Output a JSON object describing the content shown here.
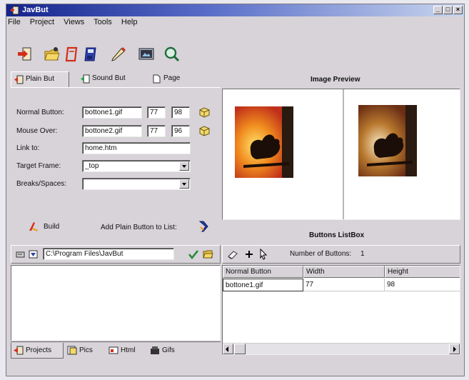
{
  "window": {
    "title": "JavBut",
    "controls": {
      "minimize": "_",
      "maximize": "□",
      "close": "×"
    }
  },
  "menu": [
    "File",
    "Project",
    "Views",
    "Tools",
    "Help"
  ],
  "toolbar_icons": [
    "exit-icon",
    "open-icon",
    "new-icon",
    "save-icon",
    "edit-icon",
    "preview-icon",
    "search-icon"
  ],
  "editor_tabs": [
    {
      "label": "Plain But",
      "icon": "plain-button-icon",
      "active": true
    },
    {
      "label": "Sound But",
      "icon": "sound-button-icon",
      "active": false
    },
    {
      "label": "Page",
      "icon": "page-icon",
      "active": false
    }
  ],
  "form": {
    "normal_button": {
      "label": "Normal Button:",
      "file": "bottone1.gif",
      "width": "77",
      "height": "98"
    },
    "mouse_over": {
      "label": "Mouse Over:",
      "file": "bottone2.gif",
      "width": "77",
      "height": "96"
    },
    "link_to": {
      "label": "Link to:",
      "value": "home.htm"
    },
    "target_frame": {
      "label": "Target Frame:",
      "value": "_top"
    },
    "breaks": {
      "label": "Breaks/Spaces:",
      "value": ""
    }
  },
  "build": {
    "label": "Build",
    "add_label": "Add Plain Button to List:"
  },
  "preview": {
    "heading": "Image Preview"
  },
  "listbox": {
    "heading": "Buttons ListBox",
    "count_label": "Number of Buttons:",
    "count": "1",
    "columns": [
      "Normal Button",
      "Width",
      "Height"
    ],
    "rows": [
      [
        "bottone1.gif",
        "77",
        "98"
      ]
    ]
  },
  "path_bar": {
    "value": "C:\\Program Files\\JavBut"
  },
  "bottom_tabs": [
    {
      "label": "Projects",
      "icon": "projects-icon",
      "active": true
    },
    {
      "label": "Pics",
      "icon": "pics-icon",
      "active": false
    },
    {
      "label": "Html",
      "icon": "html-icon",
      "active": false
    },
    {
      "label": "Gifs",
      "icon": "gifs-icon",
      "active": false
    }
  ],
  "colors": {
    "title_start": "#14238c",
    "title_end": "#c9d6ee",
    "face": "#d7d3d8",
    "accent": "#c8321e"
  }
}
